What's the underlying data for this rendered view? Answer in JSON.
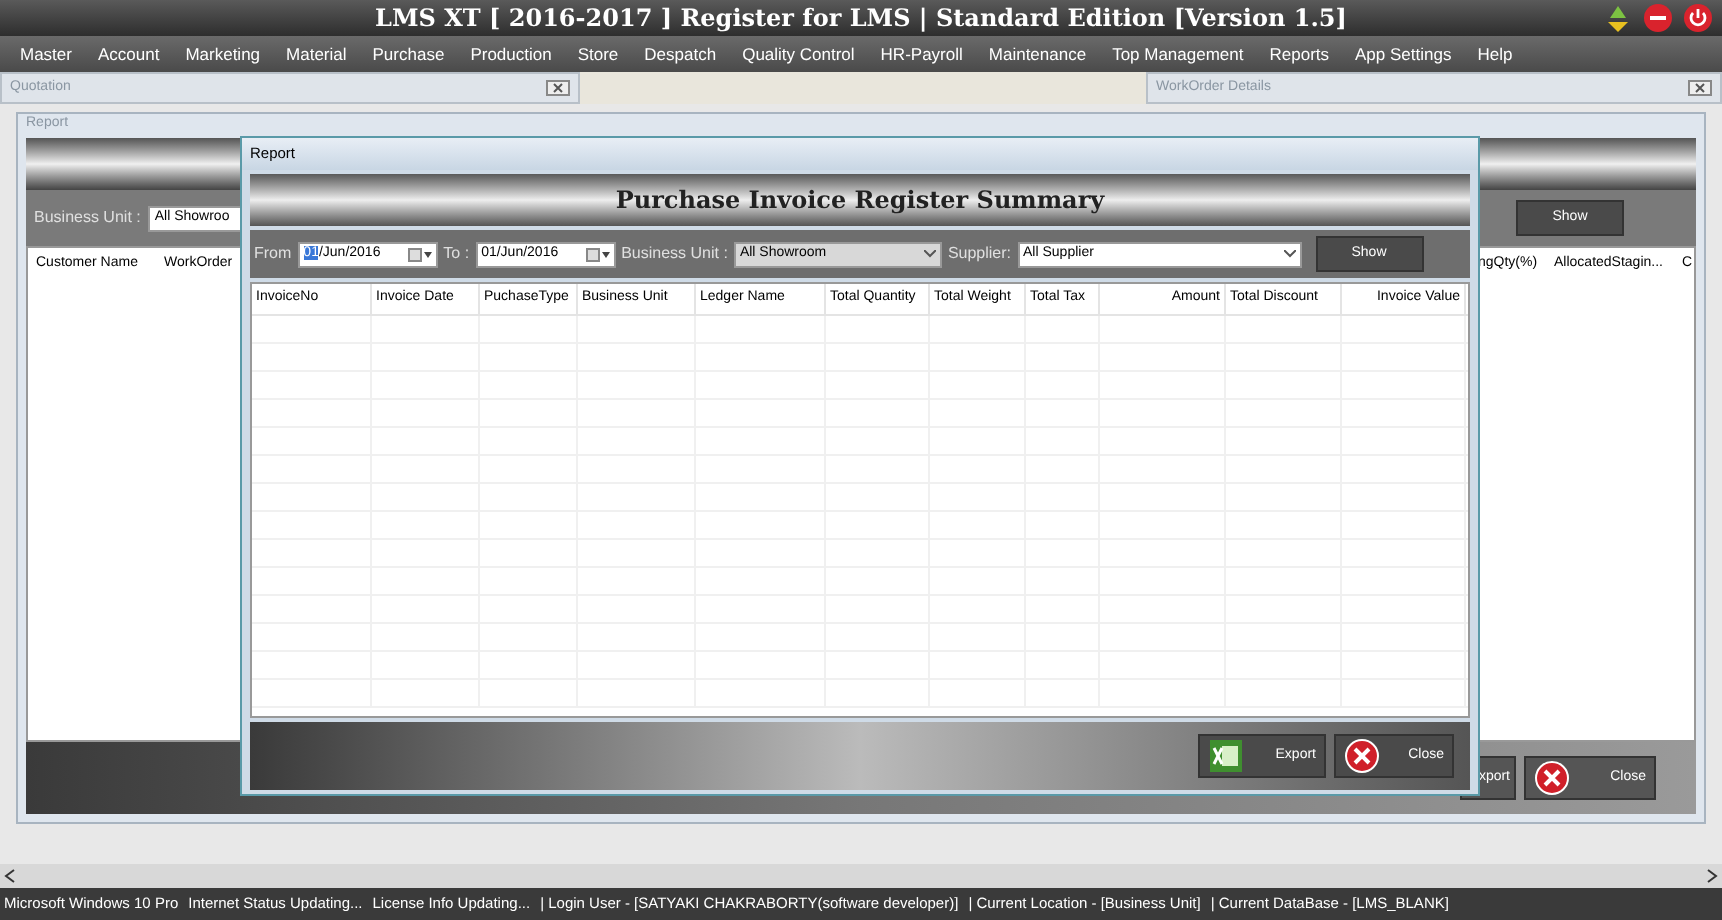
{
  "window": {
    "title": "LMS XT [ 2016-2017 ] Register for LMS | Standard Edition [Version 1.5]"
  },
  "menu": [
    "Master",
    "Account",
    "Marketing",
    "Material",
    "Purchase",
    "Production",
    "Store",
    "Despatch",
    "Quality Control",
    "HR-Payroll",
    "Maintenance",
    "Top Management",
    "Reports",
    "App Settings",
    "Help"
  ],
  "panels": [
    {
      "title": "Quotation"
    },
    {
      "title": "WorkOrder Details"
    }
  ],
  "background_report": {
    "title": "Report",
    "business_unit_label": "Business Unit :",
    "business_unit_value": "All Showroo",
    "show_button": "Show",
    "columns_left": [
      "Customer Name",
      "WorkOrder"
    ],
    "columns_right": [
      "ngQty(%)",
      "AllocatedStagin...",
      "C"
    ],
    "export_button": "xport",
    "close_button": "Close"
  },
  "dialog": {
    "title": "Report",
    "heading": "Purchase Invoice Register Summary",
    "from_label": "From",
    "from_date": "01/Jun/2016",
    "to_label": "To :",
    "to_date": "01/Jun/2016",
    "business_unit_label": "Business Unit :",
    "business_unit_value": "All Showroom",
    "supplier_label": "Supplier:",
    "supplier_value": "All Supplier",
    "show_button": "Show",
    "columns": [
      {
        "label": "InvoiceNo",
        "kind": "text"
      },
      {
        "label": "Invoice Date",
        "kind": "text"
      },
      {
        "label": "PuchaseType",
        "kind": "text"
      },
      {
        "label": "Business Unit",
        "kind": "text"
      },
      {
        "label": "Ledger Name",
        "kind": "text"
      },
      {
        "label": "Total Quantity",
        "kind": "text"
      },
      {
        "label": "Total Weight",
        "kind": "text"
      },
      {
        "label": "Total Tax",
        "kind": "text"
      },
      {
        "label": "Amount",
        "kind": "money"
      },
      {
        "label": "Total Discount",
        "kind": "text"
      },
      {
        "label": "Invoice Value",
        "kind": "money"
      }
    ],
    "export_button": "Export",
    "close_button": "Close"
  },
  "status_bar": [
    "Microsoft Windows 10 Pro",
    "Internet Status Updating...",
    "License Info Updating...",
    "| Login User - [SATYAKI CHAKRABORTY(software developer)]",
    "| Current Location - [Business Unit]",
    "| Current DataBase - [LMS_BLANK]"
  ]
}
